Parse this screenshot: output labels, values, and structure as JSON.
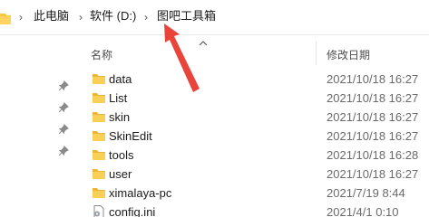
{
  "breadcrumb": {
    "items": [
      "此电脑",
      "软件 (D:)",
      "图吧工具箱"
    ],
    "separator": "›"
  },
  "columns": {
    "name": "名称",
    "date_modified": "修改日期"
  },
  "files": [
    {
      "name": "data",
      "date": "2021/10/18 16:27",
      "type": "folder"
    },
    {
      "name": "List",
      "date": "2021/10/18 16:27",
      "type": "folder"
    },
    {
      "name": "skin",
      "date": "2021/10/18 16:27",
      "type": "folder"
    },
    {
      "name": "SkinEdit",
      "date": "2021/10/18 16:27",
      "type": "folder"
    },
    {
      "name": "tools",
      "date": "2021/10/18 16:28",
      "type": "folder"
    },
    {
      "name": "user",
      "date": "2021/10/18 16:27",
      "type": "folder"
    },
    {
      "name": "ximalaya-pc",
      "date": "2021/7/19 8:44",
      "type": "folder"
    },
    {
      "name": "config.ini",
      "date": "2021/4/1 0:10",
      "type": "settings-file"
    }
  ],
  "icons": {
    "folder": "folder-icon",
    "settings_file": "settings-file-icon",
    "pin": "pin-icon",
    "sort": "sort-ascending-caret-icon"
  },
  "colors": {
    "folder": "#f6c745",
    "annotation_arrow": "#e8443a"
  }
}
